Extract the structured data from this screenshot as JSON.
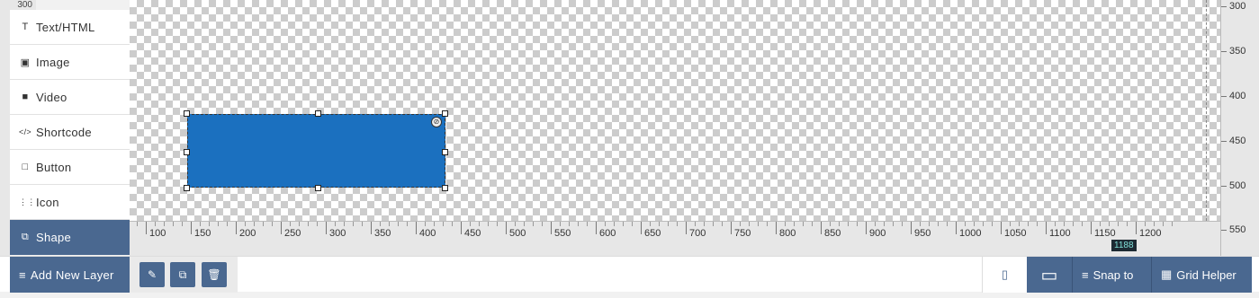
{
  "corner_label": "300",
  "sidebar": {
    "items": [
      {
        "label": "Text/HTML",
        "icon": "T"
      },
      {
        "label": "Image",
        "icon": "▣"
      },
      {
        "label": "Video",
        "icon": "■"
      },
      {
        "label": "Shortcode",
        "icon": "</>"
      },
      {
        "label": "Button",
        "icon": "□"
      },
      {
        "label": "Icon",
        "icon": "⋮⋮"
      },
      {
        "label": "Shape",
        "icon": "⧉",
        "active": true
      }
    ]
  },
  "right_ruler": [
    "300",
    "350",
    "400",
    "450",
    "500",
    "550"
  ],
  "bottom_ruler": [
    "100",
    "150",
    "200",
    "250",
    "300",
    "350",
    "400",
    "450",
    "500",
    "550",
    "600",
    "650",
    "700",
    "750",
    "800",
    "850",
    "900",
    "950",
    "1000",
    "1050",
    "1100",
    "1150",
    "1200"
  ],
  "cursor_badge": "1188",
  "toolbar": {
    "add_layer_label": "Add New Layer",
    "edit_icon": "✎",
    "duplicate_icon": "⧉",
    "delete_icon": "🗑",
    "mobile_icon": "▯",
    "desktop_icon": "▭",
    "snap_label": "Snap to",
    "grid_label": "Grid Helper"
  },
  "colors": {
    "accent": "#4a6890",
    "shape_fill": "#1b70bf"
  }
}
